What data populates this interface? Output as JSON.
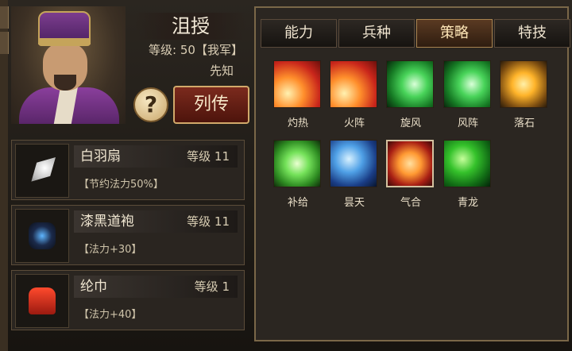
{
  "character": {
    "name": "沮授",
    "level_label": "等级:",
    "level_value": "50",
    "affiliation": "【我军】",
    "trait": "先知",
    "help_symbol": "?",
    "bio_button": "列传"
  },
  "equipment": [
    {
      "name": "白羽扇",
      "level_label": "等级",
      "level": "11",
      "effect": "【节约法力50%】",
      "icon": "feather-fan-icon"
    },
    {
      "name": "漆黑道袍",
      "level_label": "等级",
      "level": "11",
      "effect": "【法力+30】",
      "icon": "dark-robe-icon"
    },
    {
      "name": "纶巾",
      "level_label": "等级",
      "level": "1",
      "effect": "【法力+40】",
      "icon": "red-cap-icon"
    }
  ],
  "tabs": [
    {
      "label": "能力",
      "active": false
    },
    {
      "label": "兵种",
      "active": false
    },
    {
      "label": "策略",
      "active": true
    },
    {
      "label": "特技",
      "active": false
    }
  ],
  "skills": [
    {
      "label": "灼热",
      "icon": "fire-icon"
    },
    {
      "label": "火阵",
      "icon": "fire-icon"
    },
    {
      "label": "旋风",
      "icon": "wind-icon"
    },
    {
      "label": "风阵",
      "icon": "wind-icon"
    },
    {
      "label": "落石",
      "icon": "rock-icon"
    },
    {
      "label": "补给",
      "icon": "heal-icon"
    },
    {
      "label": "昙天",
      "icon": "lightning-icon"
    },
    {
      "label": "气合",
      "icon": "qi-icon"
    },
    {
      "label": "青龙",
      "icon": "dragon-icon"
    }
  ]
}
